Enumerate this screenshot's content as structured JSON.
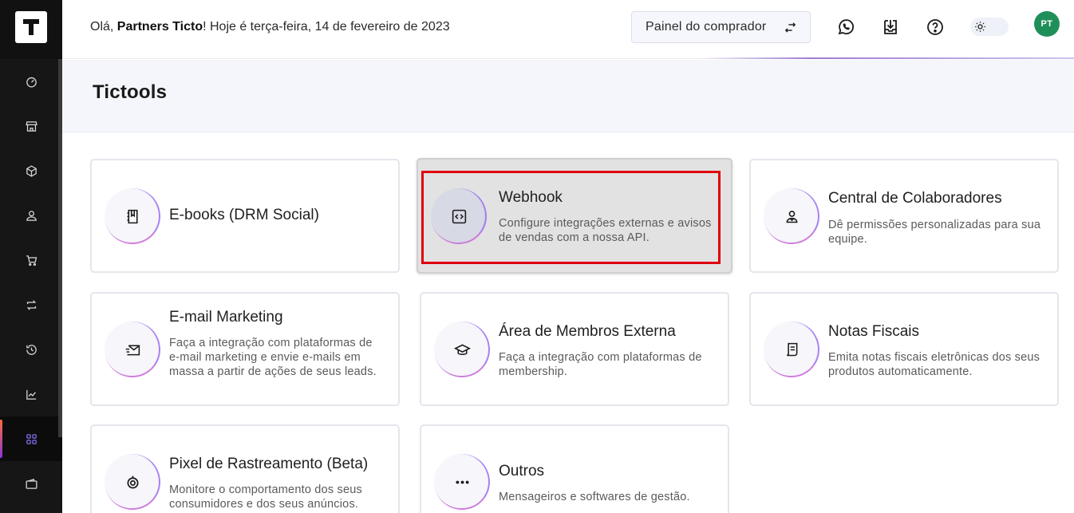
{
  "header": {
    "greeting_prefix": "Olá, ",
    "greeting_name": "Partners Ticto",
    "greeting_suffix": "! Hoje é terça-feira, 14 de fevereiro de 2023",
    "panel_button_label": "Painel do comprador",
    "avatar_initials": "PT"
  },
  "sidebar": {
    "items": [
      {
        "icon": "dashboard-icon"
      },
      {
        "icon": "store-icon"
      },
      {
        "icon": "box-icon"
      },
      {
        "icon": "users-icon"
      },
      {
        "icon": "cart-icon"
      },
      {
        "icon": "repeat-icon"
      },
      {
        "icon": "history-icon"
      },
      {
        "icon": "chart-icon"
      },
      {
        "icon": "apps-icon",
        "active": true
      },
      {
        "icon": "wallet-icon"
      }
    ]
  },
  "page": {
    "title": "Tictools"
  },
  "cards": [
    {
      "title": "E-books (DRM Social)",
      "desc": "",
      "icon": "ebook-icon"
    },
    {
      "title": "Webhook",
      "desc": "Configure integrações externas e avisos de vendas com a nossa API.",
      "icon": "code-icon",
      "selected": true
    },
    {
      "title": "Central de Colaboradores",
      "desc": "Dê permissões personalizadas para sua equipe.",
      "icon": "team-icon"
    },
    {
      "title": "E-mail Marketing",
      "desc": "Faça a integração com plataformas de e-mail marketing e envie e-mails em massa a partir de ações de seus leads.",
      "icon": "mail-send-icon"
    },
    {
      "title": "Área de Membros Externa",
      "desc": "Faça a integração com plataformas de membership.",
      "icon": "graduation-cap-icon"
    },
    {
      "title": "Notas Fiscais",
      "desc": "Emita notas fiscais eletrônicas dos seus produtos automaticamente.",
      "icon": "invoice-icon"
    },
    {
      "title": "Pixel de Rastreamento (Beta)",
      "desc": "Monitore o comportamento dos seus consumidores e dos seus anúncios.",
      "icon": "tracking-icon"
    },
    {
      "title": "Outros",
      "desc": "Mensageiros e softwares de gestão.",
      "icon": "more-icon"
    }
  ]
}
